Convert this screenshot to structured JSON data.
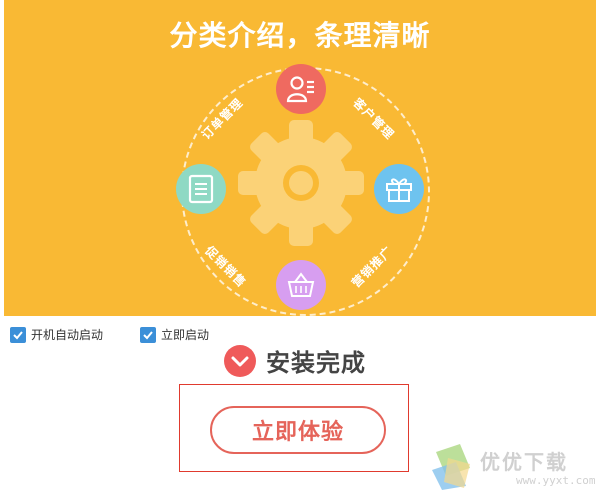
{
  "banner": {
    "headline": "分类介绍，条理清晰",
    "background_color": "#f9b934",
    "features": [
      {
        "label": "客户管理",
        "icon": "customer-management-icon",
        "color": "#ef6a60"
      },
      {
        "label": "订单管理",
        "icon": "order-list-icon",
        "color": "#8fd9c4"
      },
      {
        "label": "营销推广",
        "icon": "gift-box-icon",
        "color": "#6ec3ef"
      },
      {
        "label": "促销销售",
        "icon": "shopping-basket-icon",
        "color": "#d79ef0"
      }
    ]
  },
  "options": [
    {
      "label": "开机自动启动",
      "checked": true
    },
    {
      "label": "立即启动",
      "checked": true
    }
  ],
  "status": {
    "text": "安装完成",
    "icon": "check-circle-icon",
    "color": "#ef5a5a"
  },
  "cta": {
    "label": "立即体验",
    "color": "#e5645a"
  },
  "watermark": {
    "text": "优优下载",
    "url": "www.yyxt.com",
    "icon": "yyxt-logo-icon"
  }
}
